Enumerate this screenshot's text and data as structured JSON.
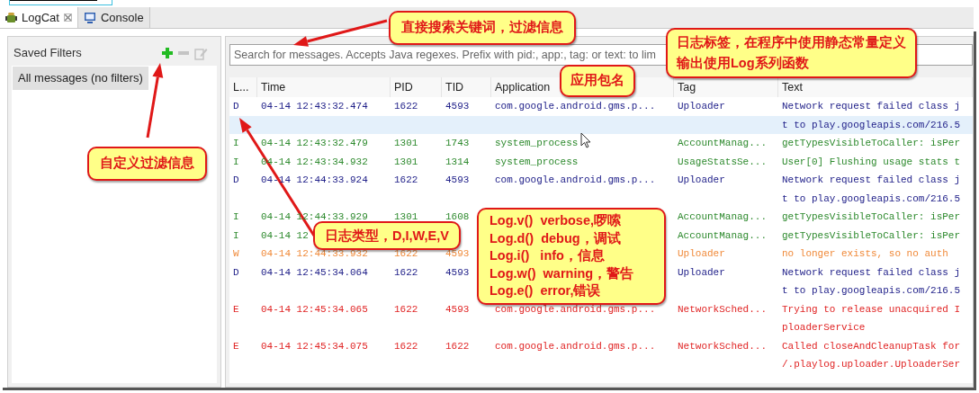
{
  "tabs": [
    {
      "label": "LogCat",
      "closable": true,
      "selected": true
    },
    {
      "label": "Console",
      "closable": false,
      "selected": false
    }
  ],
  "sidebar": {
    "title": "Saved Filters",
    "toolbar": [
      {
        "kind": "add",
        "disabled": false
      },
      {
        "kind": "remove",
        "disabled": true
      },
      {
        "kind": "edit",
        "disabled": true
      }
    ],
    "items": [
      {
        "label": "All messages (no filters)",
        "selected": true
      }
    ]
  },
  "search": {
    "placeholder": "Search for messages. Accepts Java regexes. Prefix with pid:, app:, tag: or text: to lim"
  },
  "table": {
    "columns": [
      "L...",
      "Time",
      "PID",
      "TID",
      "Application",
      "Tag",
      "Text"
    ],
    "rows": [
      {
        "kind": "debug",
        "selected": true,
        "cells": [
          "D",
          "04-14 12:43:32.474",
          "1622",
          "4593",
          "com.google.android.gms.p...",
          "Uploader",
          "Network request failed class j"
        ],
        "continuation": "t to play.googleapis.com/216.5"
      },
      {
        "kind": "info",
        "selected": false,
        "cells": [
          "I",
          "04-14 12:43:32.479",
          "1301",
          "1743",
          "system_process",
          "AccountManag...",
          "getTypesVisibleToCaller: isPer"
        ]
      },
      {
        "kind": "info",
        "selected": false,
        "cells": [
          "I",
          "04-14 12:43:34.932",
          "1301",
          "1314",
          "system_process",
          "UsageStatsSe...",
          "User[0] Flushing usage stats t"
        ]
      },
      {
        "kind": "debug",
        "selected": false,
        "cells": [
          "D",
          "04-14 12:44:33.924",
          "1622",
          "4593",
          "com.google.android.gms.p...",
          "Uploader",
          "Network request failed class j"
        ],
        "continuation": "t to play.googleapis.com/216.5"
      },
      {
        "kind": "info",
        "selected": false,
        "cells": [
          "I",
          "04-14 12:44:33.929",
          "1301",
          "1608",
          null,
          "AccountManag...",
          "getTypesVisibleToCaller: isPer"
        ]
      },
      {
        "kind": "info",
        "selected": false,
        "cells": [
          "I",
          "04-14 12",
          null,
          null,
          null,
          "AccountManag...",
          "getTypesVisibleToCaller: isPer"
        ]
      },
      {
        "kind": "warning",
        "selected": false,
        "cells": [
          "W",
          "04-14 12:44:33.932",
          "1622",
          "4593",
          null,
          "Uploader",
          "no longer exists, so no auth"
        ]
      },
      {
        "kind": "debug",
        "selected": false,
        "cells": [
          "D",
          "04-14 12:45:34.064",
          "1622",
          "4593",
          null,
          "Uploader",
          "Network request failed class j"
        ],
        "continuation": "t to play.googleapis.com/216.5"
      },
      {
        "kind": "error",
        "selected": false,
        "cells": [
          "E",
          "04-14 12:45:34.065",
          "1622",
          "4593",
          "com.google.android.gms.p...",
          "NetworkSched...",
          "Trying to release unacquired I"
        ],
        "continuation": "ploaderService"
      },
      {
        "kind": "error",
        "selected": false,
        "cells": [
          "E",
          "04-14 12:45:34.075",
          "1622",
          "1622",
          "com.google.android.gms.p...",
          "NetworkSched...",
          "Called closeAndCleanupTask for"
        ],
        "continuation": "/.playlog.uploader.UploaderSer"
      }
    ]
  },
  "annotations": [
    {
      "kind": "search",
      "lines": [
        "直接搜索关键词，过滤信息"
      ]
    },
    {
      "kind": "tag",
      "lines": [
        "日志标签，在程序中使用静态常量定义",
        "输出使用Log系列函数"
      ]
    },
    {
      "kind": "app",
      "lines": [
        "应用包名"
      ]
    },
    {
      "kind": "filter",
      "lines": [
        "自定义过滤信息"
      ]
    },
    {
      "kind": "level",
      "lines": [
        "日志类型，D,I,W,E,V"
      ]
    },
    {
      "kind": "methods",
      "lines": [
        "Log.v()  verbose,啰嗦",
        "Log.d()  debug，调试",
        "Log.i()   info，信息",
        "Log.w()  warning，警告",
        "Log.e()  error,错误"
      ]
    }
  ]
}
